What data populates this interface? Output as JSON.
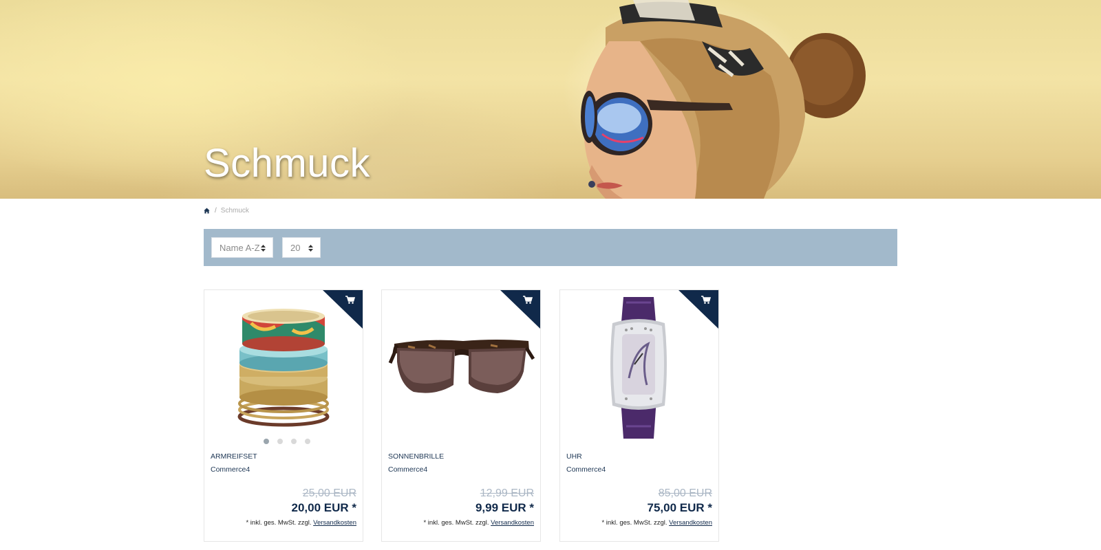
{
  "hero": {
    "title": "Schmuck"
  },
  "breadcrumb": {
    "home_icon": "home-icon",
    "separator": "/",
    "current": "Schmuck"
  },
  "toolbar": {
    "sort": {
      "selected": "Name A-Z"
    },
    "per_page": {
      "selected": "20"
    }
  },
  "colors": {
    "toolbar_bg": "#a2b9cb",
    "brand_dark": "#10294a",
    "old_price": "#aab6c4"
  },
  "products": [
    {
      "name": "ARMREIFSET",
      "manufacturer": "Commerce4",
      "old_price": "25,00 EUR",
      "price": "20,00 EUR *",
      "tax_note": "* inkl. ges. MwSt. zzgl.",
      "shipping_link": "Versandkosten",
      "image": "bangles",
      "cart_icon": "cart-icon",
      "slider_dots": 4,
      "active_dot": 1
    },
    {
      "name": "SONNENBRILLE",
      "manufacturer": "Commerce4",
      "old_price": "12,99 EUR",
      "price": "9,99 EUR *",
      "tax_note": "* inkl. ges. MwSt. zzgl.",
      "shipping_link": "Versandkosten",
      "image": "sunglasses",
      "cart_icon": "cart-icon"
    },
    {
      "name": "UHR",
      "manufacturer": "Commerce4",
      "old_price": "85,00 EUR",
      "price": "75,00 EUR *",
      "tax_note": "* inkl. ges. MwSt. zzgl.",
      "shipping_link": "Versandkosten",
      "image": "watch",
      "cart_icon": "cart-icon"
    }
  ]
}
